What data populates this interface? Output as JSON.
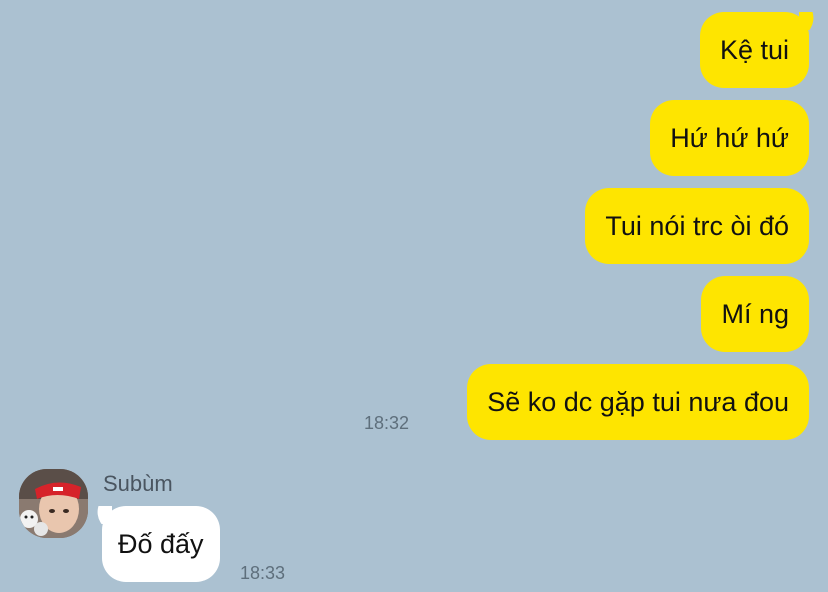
{
  "sent_messages": [
    {
      "text": "Kệ tui"
    },
    {
      "text": "Hứ hứ hứ"
    },
    {
      "text": "Tui nói trc òi đó"
    },
    {
      "text": "Mí ng"
    },
    {
      "text": "Sẽ ko dc gặp tui nưa đou",
      "time": "18:32"
    }
  ],
  "received": {
    "sender_name": "Subùm",
    "messages": [
      {
        "text": "Đố đấy",
        "time": "18:33"
      }
    ]
  },
  "colors": {
    "background": "#abc1d1",
    "sent_bubble": "#fee500",
    "received_bubble": "#ffffff"
  }
}
